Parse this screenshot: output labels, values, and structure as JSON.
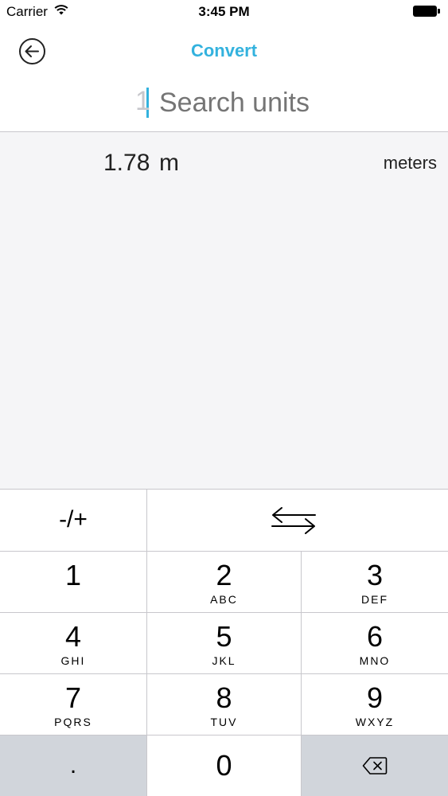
{
  "status_bar": {
    "carrier": "Carrier",
    "time": "3:45 PM",
    "wifi_icon": "wifi-icon",
    "battery_icon": "battery-icon"
  },
  "nav": {
    "title": "Convert",
    "back_icon": "back-arrow-circle-icon",
    "accent_color": "#33b2de"
  },
  "search": {
    "value": "1",
    "placeholder": "Search units"
  },
  "results": [
    {
      "value": "1.78",
      "symbol": "m",
      "name": "meters"
    }
  ],
  "keypad": {
    "sign_toggle": "-/+",
    "swap_icon": "swap-arrows-icon",
    "keys": [
      {
        "digit": "1",
        "letters": ""
      },
      {
        "digit": "2",
        "letters": "ABC"
      },
      {
        "digit": "3",
        "letters": "DEF"
      },
      {
        "digit": "4",
        "letters": "GHI"
      },
      {
        "digit": "5",
        "letters": "JKL"
      },
      {
        "digit": "6",
        "letters": "MNO"
      },
      {
        "digit": "7",
        "letters": "PQRS"
      },
      {
        "digit": "8",
        "letters": "TUV"
      },
      {
        "digit": "9",
        "letters": "WXYZ"
      }
    ],
    "decimal": ".",
    "zero": "0",
    "delete_icon": "backspace-icon"
  }
}
